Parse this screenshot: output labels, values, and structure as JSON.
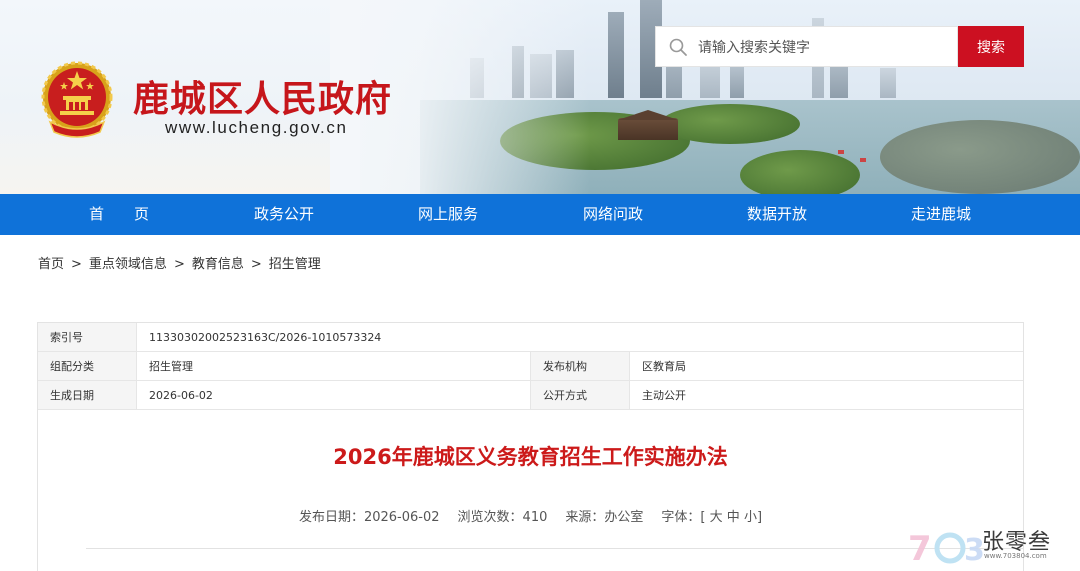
{
  "header": {
    "site_name": "鹿城区人民政府",
    "site_url": "www.lucheng.gov.cn",
    "search": {
      "placeholder": "请输入搜索关键字",
      "button_label": "搜索"
    }
  },
  "nav": {
    "items": [
      {
        "label": "首　　页"
      },
      {
        "label": "政务公开"
      },
      {
        "label": "网上服务"
      },
      {
        "label": "网络问政"
      },
      {
        "label": "数据开放"
      },
      {
        "label": "走进鹿城"
      }
    ]
  },
  "breadcrumb": {
    "items": [
      "首页",
      "重点领域信息",
      "教育信息",
      "招生管理"
    ],
    "separator": ">"
  },
  "meta": {
    "index_label": "索引号",
    "index_value": "11330302002523163C/2026-1010573324",
    "category_label": "组配分类",
    "category_value": "招生管理",
    "publisher_label": "发布机构",
    "publisher_value": "区教育局",
    "date_label": "生成日期",
    "date_value": "2026-06-02",
    "disclosure_label": "公开方式",
    "disclosure_value": "主动公开"
  },
  "article": {
    "title": "2026年鹿城区义务教育招生工作实施办法",
    "publish_date_label": "发布日期：",
    "publish_date": "2026-06-02",
    "views_label": "浏览次数：",
    "views": "410",
    "source_label": "来源：",
    "source": "办公室",
    "font_label": "字体：[",
    "font_large": "大",
    "font_medium": "中",
    "font_small": "小",
    "font_close": "]"
  },
  "watermark": {
    "text": "张零叁",
    "sub": "www.703804.com"
  },
  "colors": {
    "brand_red": "#cc1021",
    "nav_blue": "#0f72d9",
    "title_red": "#cc1a1a"
  },
  "icons": {
    "search": "search-icon",
    "emblem": "national-emblem-icon"
  }
}
